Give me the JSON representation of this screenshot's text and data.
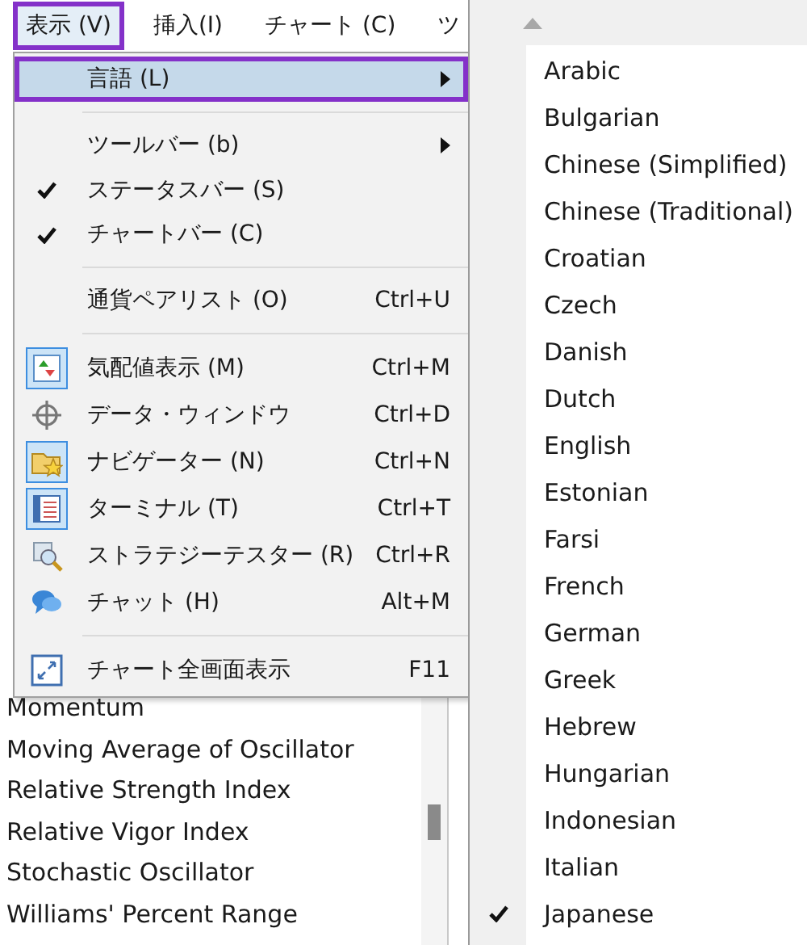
{
  "menubar": [
    {
      "label": "表示 (V)",
      "selected": true
    },
    {
      "label": "挿入(I)",
      "selected": false
    },
    {
      "label": "チャート (C)",
      "selected": false
    },
    {
      "label": "ツ",
      "selected": false
    }
  ],
  "view_menu": [
    {
      "kind": "item",
      "label": "言語 (L)",
      "submenu": true,
      "selected": true,
      "checked": false
    },
    {
      "kind": "separator"
    },
    {
      "kind": "item",
      "label": "ツールバー (b)",
      "submenu": true,
      "selected": false,
      "checked": false
    },
    {
      "kind": "item",
      "label": "ステータスバー (S)",
      "selected": false,
      "checked": true
    },
    {
      "kind": "item",
      "label": "チャートバー (C)",
      "selected": false,
      "checked": true
    },
    {
      "kind": "separator"
    },
    {
      "kind": "item",
      "label": "通貨ペアリスト (O)",
      "shortcut": "Ctrl+U",
      "selected": false,
      "checked": false
    },
    {
      "kind": "separator"
    },
    {
      "kind": "item",
      "label": "気配値表示 (M)",
      "shortcut": "Ctrl+M",
      "selected": false,
      "checked": true
    },
    {
      "kind": "item",
      "label": "データ・ウィンドウ",
      "shortcut": "Ctrl+D",
      "selected": false,
      "checked": false
    },
    {
      "kind": "item",
      "label": "ナビゲーター (N)",
      "shortcut": "Ctrl+N",
      "selected": false,
      "checked": true
    },
    {
      "kind": "item",
      "label": "ターミナル (T)",
      "shortcut": "Ctrl+T",
      "selected": false,
      "checked": true
    },
    {
      "kind": "item",
      "label": "ストラテジーテスター (R)",
      "shortcut": "Ctrl+R",
      "selected": false,
      "checked": false
    },
    {
      "kind": "item",
      "label": "チャット (H)",
      "shortcut": "Alt+M",
      "selected": false,
      "checked": false
    },
    {
      "kind": "separator"
    },
    {
      "kind": "item",
      "label": "チャート全画面表示",
      "shortcut": "F11",
      "selected": false,
      "checked": false
    }
  ],
  "indicators": [
    "Momentum",
    "Moving Average of Oscillator",
    "Relative Strength Index",
    "Relative Vigor Index",
    "Stochastic Oscillator",
    "Williams' Percent Range"
  ],
  "languages": [
    {
      "label": "Arabic",
      "selected": false
    },
    {
      "label": "Bulgarian",
      "selected": false
    },
    {
      "label": "Chinese (Simplified)",
      "selected": false
    },
    {
      "label": "Chinese (Traditional)",
      "selected": false
    },
    {
      "label": "Croatian",
      "selected": false
    },
    {
      "label": "Czech",
      "selected": false
    },
    {
      "label": "Danish",
      "selected": false
    },
    {
      "label": "Dutch",
      "selected": false
    },
    {
      "label": "English",
      "selected": false
    },
    {
      "label": "Estonian",
      "selected": false
    },
    {
      "label": "Farsi",
      "selected": false
    },
    {
      "label": "French",
      "selected": false
    },
    {
      "label": "German",
      "selected": false
    },
    {
      "label": "Greek",
      "selected": false
    },
    {
      "label": "Hebrew",
      "selected": false
    },
    {
      "label": "Hungarian",
      "selected": false
    },
    {
      "label": "Indonesian",
      "selected": false
    },
    {
      "label": "Italian",
      "selected": false
    },
    {
      "label": "Japanese",
      "selected": true
    }
  ]
}
